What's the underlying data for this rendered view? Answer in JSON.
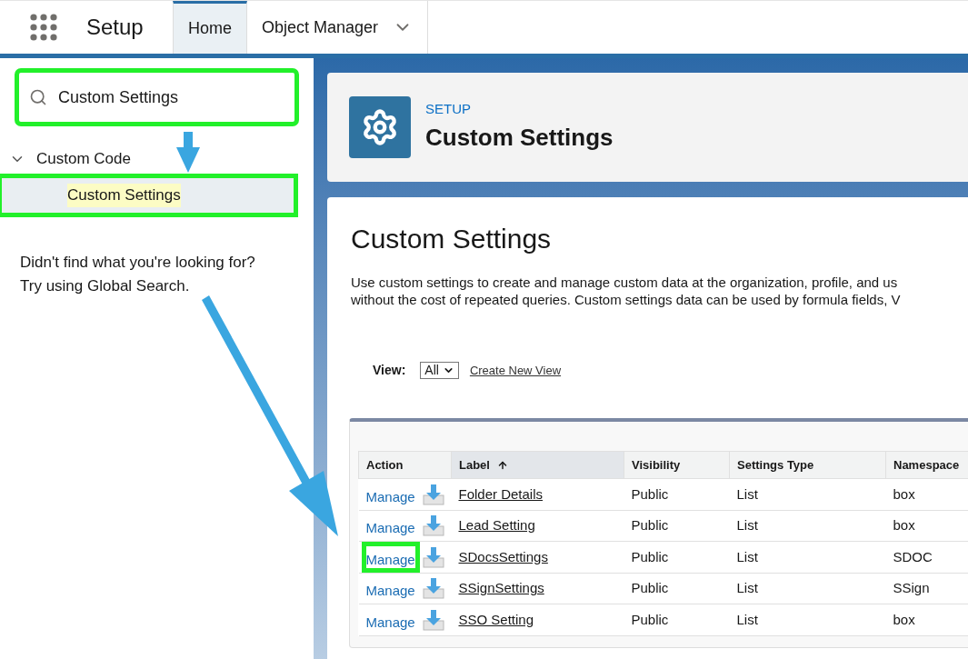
{
  "app_name": "Setup",
  "tabs": [
    {
      "label": "Home",
      "selected": true
    },
    {
      "label": "Object Manager",
      "selected": false
    }
  ],
  "sidebar": {
    "search": {
      "value": "Custom Settings",
      "highlighted": true
    },
    "tree": [
      {
        "label": "Custom Code",
        "expanded": true,
        "children": [
          {
            "label": "Custom Settings",
            "selected": true,
            "highlighted": true
          }
        ]
      }
    ],
    "hint": [
      "Didn't find what you're looking for?",
      "Try using Global Search."
    ]
  },
  "header": {
    "eyebrow": "SETUP",
    "title": "Custom Settings"
  },
  "page": {
    "title": "Custom Settings",
    "description": [
      "Use custom settings to create and manage custom data at the organization, profile, and us",
      "without the cost of repeated queries. Custom settings data can be used by formula fields, V"
    ],
    "view": {
      "label": "View:",
      "value": "All",
      "link": "Create New View"
    }
  },
  "table": {
    "columns": [
      {
        "label": "Action",
        "sorted": false
      },
      {
        "label": "Label",
        "sorted": true
      },
      {
        "label": "Visibility",
        "sorted": false
      },
      {
        "label": "Settings Type",
        "sorted": false
      },
      {
        "label": "Namespace",
        "sorted": false
      }
    ],
    "rows": [
      {
        "action": "Manage",
        "label": "Folder Details",
        "visibility": "Public",
        "type": "List",
        "namespace": "box",
        "highlighted": false
      },
      {
        "action": "Manage",
        "label": "Lead Setting",
        "visibility": "Public",
        "type": "List",
        "namespace": "box",
        "highlighted": false
      },
      {
        "action": "Manage",
        "label": "SDocsSettings",
        "visibility": "Public",
        "type": "List",
        "namespace": "SDOC",
        "highlighted": true
      },
      {
        "action": "Manage",
        "label": "SSignSettings",
        "visibility": "Public",
        "type": "List",
        "namespace": "SSign",
        "highlighted": false
      },
      {
        "action": "Manage",
        "label": "SSO Setting",
        "visibility": "Public",
        "type": "List",
        "namespace": "box",
        "highlighted": false
      }
    ]
  }
}
